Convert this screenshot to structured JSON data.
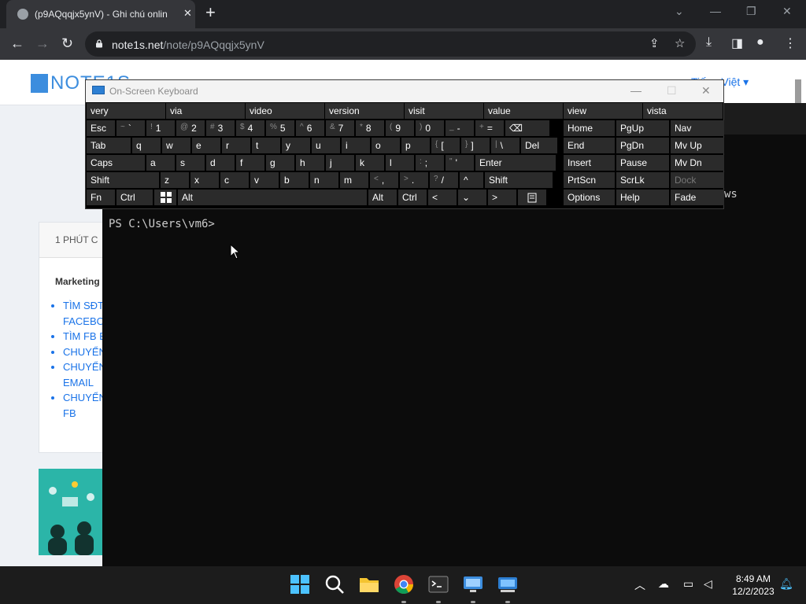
{
  "browser": {
    "tab_title": "(p9AQqqjx5ynV) - Ghi chú onlin",
    "tab_close": "✕",
    "new_tab": "+",
    "url_host": "note1s.net",
    "url_path": "/note/p9AQqqjx5ynV",
    "window_controls": [
      "⌄",
      "—",
      "❐",
      "✕"
    ]
  },
  "website": {
    "logo_text": "NOTE1S",
    "language": "Tiếng Việt ▾",
    "card_heading": "1 PHÚT C",
    "card_subheading": "Marketing",
    "card_links": [
      "TÌM SĐT FACEBO",
      "TÌM FB B",
      "CHUYỂN",
      "CHUYỂN EMAIL",
      "CHUYỂN UID-FB"
    ]
  },
  "terminal": {
    "prompt": "PS C:\\Users\\vm6>",
    "behind_text": "ws"
  },
  "osk": {
    "title": "On-Screen Keyboard",
    "predictions": [
      "very",
      "via",
      "video",
      "version",
      "visit",
      "value",
      "view",
      "vista"
    ],
    "row1": [
      {
        "label": "Esc"
      },
      {
        "shift": "~",
        "label": "`"
      },
      {
        "shift": "!",
        "label": "1"
      },
      {
        "shift": "@",
        "label": "2"
      },
      {
        "shift": "#",
        "label": "3"
      },
      {
        "shift": "$",
        "label": "4"
      },
      {
        "shift": "%",
        "label": "5"
      },
      {
        "shift": "^",
        "label": "6"
      },
      {
        "shift": "&",
        "label": "7"
      },
      {
        "shift": "*",
        "label": "8"
      },
      {
        "shift": "(",
        "label": "9"
      },
      {
        "shift": ")",
        "label": "0"
      },
      {
        "shift": "_",
        "label": "-"
      },
      {
        "shift": "+",
        "label": "="
      },
      {
        "label": "⌫"
      }
    ],
    "row2": [
      "Tab",
      "q",
      "w",
      "e",
      "r",
      "t",
      "y",
      "u",
      "i",
      "o",
      "p",
      "[",
      "]",
      "\\",
      "Del"
    ],
    "row2_shift": [
      "",
      "",
      "",
      "",
      "",
      "",
      "",
      "",
      "",
      "",
      "",
      "{",
      "}",
      "|",
      ""
    ],
    "row3": [
      "Caps",
      "a",
      "s",
      "d",
      "f",
      "g",
      "h",
      "j",
      "k",
      "l",
      ";",
      "'",
      "Enter"
    ],
    "row3_shift": [
      "",
      "",
      "",
      "",
      "",
      "",
      "",
      "",
      "",
      "",
      ":",
      "\"",
      ""
    ],
    "row4": [
      "Shift",
      "z",
      "x",
      "c",
      "v",
      "b",
      "n",
      "m",
      ",",
      ".",
      "/",
      "^",
      "Shift"
    ],
    "row4_shift": [
      "",
      "",
      "",
      "",
      "",
      "",
      "",
      "",
      "<",
      ">",
      "?",
      "",
      ""
    ],
    "row5": [
      "Fn",
      "Ctrl",
      "",
      "Alt",
      "",
      "Alt",
      "Ctrl",
      "<",
      "⌄",
      ">",
      ""
    ],
    "nav_keys": [
      [
        "Home",
        "PgUp",
        "Nav"
      ],
      [
        "End",
        "PgDn",
        "Mv Up"
      ],
      [
        "Insert",
        "Pause",
        "Mv Dn"
      ],
      [
        "PrtScn",
        "ScrLk",
        "Dock"
      ],
      [
        "Options",
        "Help",
        "Fade"
      ]
    ]
  },
  "taskbar": {
    "time": "8:49 AM",
    "date": "12/2/2023",
    "apps": [
      "windows-start-icon",
      "search-icon",
      "file-explorer-icon",
      "chrome-icon",
      "terminal-icon",
      "remote-desktop-icon",
      "osk-icon"
    ]
  },
  "colors": {
    "accent_blue": "#3c8dde",
    "key_bg": "#2b2b2b",
    "terminal_bg": "#0c0c0c"
  }
}
